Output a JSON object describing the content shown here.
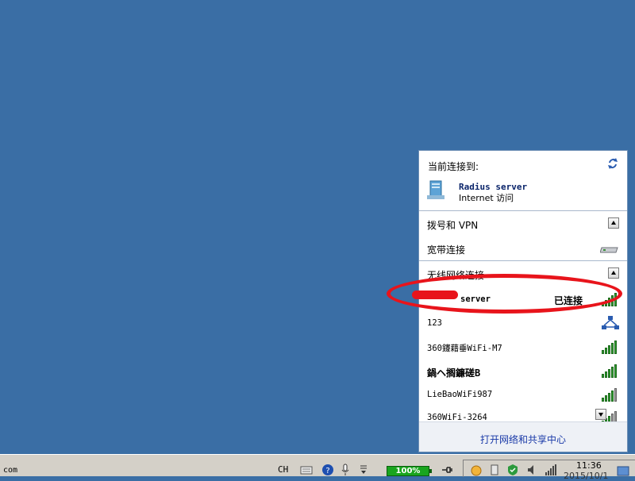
{
  "flyout": {
    "title": "当前连接到:",
    "current": {
      "name": "Radius server",
      "status": "Internet 访问"
    },
    "sections": {
      "dialup": "拨号和 VPN",
      "broadband": "宽带连接",
      "wireless": "无线网络连接"
    },
    "networks": [
      {
        "ssid": "server",
        "status": "已连接",
        "secure": true
      },
      {
        "ssid": "123",
        "status": "",
        "adhoc": true
      },
      {
        "ssid": "360鑳藉垂WiFi-M7",
        "status": ""
      },
      {
        "ssid": "鍋ヘ搁鐮磋B",
        "status": ""
      },
      {
        "ssid": "LieBaoWiFi987",
        "status": ""
      },
      {
        "ssid": "360WiFi-3264",
        "status": ""
      }
    ],
    "footer_link": "打开网络和共享中心"
  },
  "taskbar": {
    "left_text": "com",
    "language": "CH",
    "battery": "100%",
    "time": "11:36",
    "date": "2015/10/1"
  },
  "colors": {
    "desktop": "#3a6ea5",
    "highlight": "#e8141b",
    "signal": "#2f9b2f"
  }
}
